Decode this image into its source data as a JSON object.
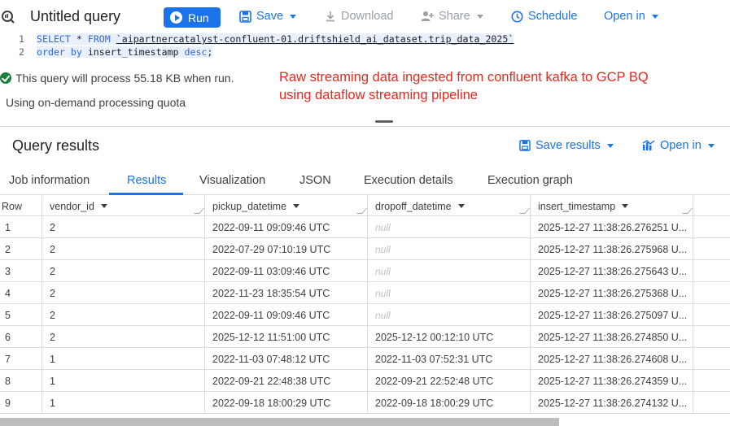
{
  "toolbar": {
    "title": "Untitled query",
    "run_label": "Run",
    "save_label": "Save",
    "download_label": "Download",
    "share_label": "Share",
    "schedule_label": "Schedule",
    "open_in_label": "Open in"
  },
  "editor": {
    "lines": [
      {
        "number": "1",
        "keyword1": "SELECT",
        "star": " * ",
        "keyword2": "FROM",
        "table": "`aipartnercatalyst-confluent-01.driftshield_ai_dataset.trip_data_2025`"
      },
      {
        "number": "2",
        "keyword1": "order by",
        "rest": " insert_timestamp ",
        "keyword2": "desc",
        "end": ";"
      }
    ]
  },
  "validation": {
    "message": "This query will process 55.18 KB when run.",
    "quota": "Using on-demand processing quota"
  },
  "annotation": {
    "line1": "Raw streaming data ingested from confluent kafka to GCP BQ",
    "line2": "using dataflow streaming pipeline",
    "color": "#e8281e"
  },
  "results": {
    "title": "Query results",
    "save_results_label": "Save results",
    "open_in_label": "Open in",
    "tabs": [
      "Job information",
      "Results",
      "Visualization",
      "JSON",
      "Execution details",
      "Execution graph"
    ],
    "active_tab": "Results",
    "columns": [
      "Row",
      "vendor_id",
      "pickup_datetime",
      "dropoff_datetime",
      "insert_timestamp"
    ],
    "rows": [
      {
        "row": "1",
        "vendor_id": "2",
        "pickup": "2022-09-11 09:09:46 UTC",
        "dropoff": "null",
        "insert": "2025-12-27 11:38:26.276251 U..."
      },
      {
        "row": "2",
        "vendor_id": "2",
        "pickup": "2022-07-29 07:10:19 UTC",
        "dropoff": "null",
        "insert": "2025-12-27 11:38:26.275968 U..."
      },
      {
        "row": "3",
        "vendor_id": "2",
        "pickup": "2022-09-11 03:09:46 UTC",
        "dropoff": "null",
        "insert": "2025-12-27 11:38:26.275643 U..."
      },
      {
        "row": "4",
        "vendor_id": "2",
        "pickup": "2022-11-23 18:35:54 UTC",
        "dropoff": "null",
        "insert": "2025-12-27 11:38:26.275368 U..."
      },
      {
        "row": "5",
        "vendor_id": "2",
        "pickup": "2022-09-11 09:09:46 UTC",
        "dropoff": "null",
        "insert": "2025-12-27 11:38:26.275097 U..."
      },
      {
        "row": "6",
        "vendor_id": "2",
        "pickup": "2025-12-12 11:51:00 UTC",
        "dropoff": "2025-12-12 00:12:10 UTC",
        "insert": "2025-12-27 11:38:26.274850 U..."
      },
      {
        "row": "7",
        "vendor_id": "1",
        "pickup": "2022-11-03 07:48:12 UTC",
        "dropoff": "2022-11-03 07:52:31 UTC",
        "insert": "2025-12-27 11:38:26.274608 U..."
      },
      {
        "row": "8",
        "vendor_id": "1",
        "pickup": "2022-09-21 22:48:38 UTC",
        "dropoff": "2022-09-21 22:52:48 UTC",
        "insert": "2025-12-27 11:38:26.274359 U..."
      },
      {
        "row": "9",
        "vendor_id": "1",
        "pickup": "2022-09-18 18:00:29 UTC",
        "dropoff": "2022-09-18 18:00:29 UTC",
        "insert": "2025-12-27 11:38:26.274132 U..."
      }
    ]
  },
  "icons": {
    "query_tab": "query-icon",
    "run": "play-icon",
    "save": "save-icon",
    "download": "download-icon",
    "share": "share-icon",
    "schedule": "clock-icon",
    "valid": "check-circle-icon",
    "save_results": "save-icon",
    "open_in_results": "chart-icon"
  },
  "colors": {
    "accent": "#1a73e8",
    "success": "#188038",
    "disabled": "#9aa0a6"
  }
}
